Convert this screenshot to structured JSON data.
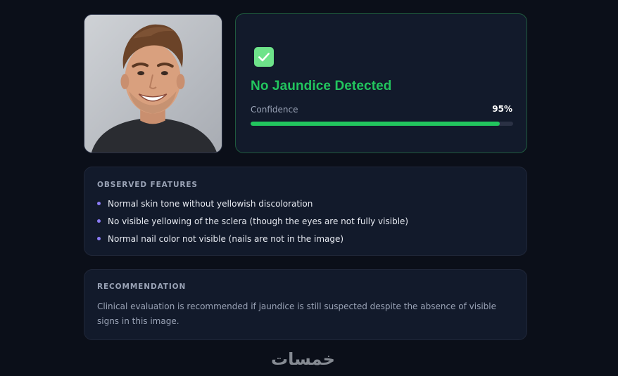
{
  "photo": {
    "alt_icon": "person-photo"
  },
  "result": {
    "icon": "check-icon",
    "title": "No Jaundice Detected",
    "confidence_label": "Confidence",
    "confidence_value": "95%",
    "confidence_fraction": 0.95,
    "accent_color": "#22c55e"
  },
  "features": {
    "heading": "OBSERVED FEATURES",
    "items": [
      "Normal skin tone without yellowish discoloration",
      "No visible yellowing of the sclera (though the eyes are not fully visible)",
      "Normal nail color not visible (nails are not in the image)"
    ]
  },
  "recommendation": {
    "heading": "RECOMMENDATION",
    "text": "Clinical evaluation is recommended if jaundice is still suspected despite the absence of visible signs in this image."
  },
  "watermark": {
    "text": "خمسات"
  }
}
